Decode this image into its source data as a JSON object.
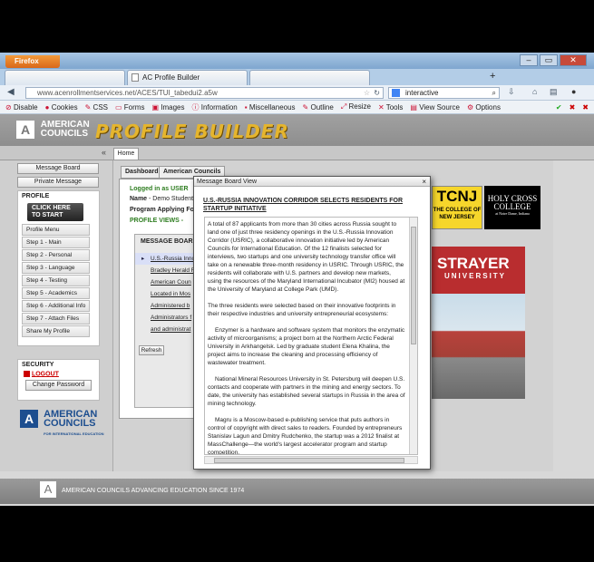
{
  "browser": {
    "menu_label": "Firefox",
    "tabs": [
      {
        "label": "AC Profile Builder"
      },
      {
        "label": ""
      }
    ],
    "new_tab": "+",
    "url": "www.acenrollmentservices.net/ACES/TUI_tabedui2.a5w",
    "search_value": "interactive",
    "window_buttons": [
      "–",
      "▭",
      "✕"
    ],
    "webdev_toolbar": [
      "Disable",
      "Cookies",
      "CSS",
      "Forms",
      "Images",
      "Information",
      "Miscellaneous",
      "Outline",
      "Resize",
      "Tools",
      "View Source",
      "Options"
    ]
  },
  "header": {
    "logo_line1": "AMERICAN",
    "logo_line2": "COUNCILS",
    "app_title": "PROFILE BUILDER",
    "collapse_icon": "«",
    "home_tab": "Home"
  },
  "sidebar": {
    "top_buttons": [
      "Message Board",
      "Private Message"
    ],
    "profile_title": "PROFILE",
    "click_to_start": [
      "CLICK HERE",
      "TO START"
    ],
    "profile_items": [
      "Profile Menu",
      "Step 1 - Main",
      "Step 2 - Personal",
      "Step 3 - Language",
      "Step 4 - Testing",
      "Step 5 - Academics",
      "Step 6 - Additional Info",
      "Step 7 - Attach Files",
      "Share My Profile"
    ],
    "security_title": "SECURITY",
    "logout": "LOGOUT",
    "change_password": "Change Password",
    "logo_line1": "AMERICAN",
    "logo_line2": "COUNCILS",
    "logo_tagline": "FOR INTERNATIONAL EDUCATION"
  },
  "content": {
    "tabs": [
      "Dashboard",
      "American Councils"
    ],
    "logged_in": "Logged in as USER",
    "name_label": "Name",
    "name_value": "- Demo Student",
    "program_label": "Program Applying For",
    "program_value": "-",
    "profile_views": "PROFILE VIEWS -",
    "message_board_title": "MESSAGE BOARD",
    "messages": [
      "U.S.-Russia Innovation",
      "Bradley Herald F",
      "American Coun",
      "Located in Mos",
      "Administered b",
      "Administrators f",
      "and administrat"
    ],
    "refresh": "Refresh",
    "tcnj": {
      "big": "TCNJ",
      "line1": "THE COLLEGE OF",
      "line2": "NEW JERSEY"
    },
    "holy_cross": {
      "line1": "HOLY CROSS",
      "line2": "COLLEGE",
      "line3": "at Notre Dame, Indiana"
    },
    "strayer": {
      "line1": "STRAYER",
      "line2": "UNIVERSITY"
    }
  },
  "modal": {
    "title": "Message Board View",
    "close": "×",
    "headline": "U.S.-RUSSIA INNOVATION CORRIDOR SELECTS RESIDENTS FOR STARTUP INITIATIVE",
    "paragraphs": [
      "A total of 87 applicants from more than 30 cities across Russia sought to land one of just three residency openings in the U.S.-Russia Innovation Corridor (USRIC), a collaborative innovation initiative led by American Councils for International Education. Of the 12 finalists selected for interviews, two startups and one university technology transfer office will take on a renewable three-month residency in USRIC. Through USRIC, the residents will collaborate with U.S. partners and develop new markets, using the resources of the Maryland International Incubator (MI2) housed at the University of Maryland at College Park (UMD).",
      "The three residents were selected based on their innovative footprints in their respective industries and university entrepreneurial ecosystems:",
      "Enzymer is a hardware and software system that monitors the enzymatic activity of microorganisms; a project born at the Northern Arctic Federal University in Arkhangelsk. Led by graduate student Elena Khalina, the project aims to increase the cleaning and processing efficiency of wastewater treatment.",
      "National Mineral Resources University in St. Petersburg will deepen U.S. contacts and cooperate with partners in the mining and energy sectors. To date, the university has established several startups in Russia in the area of mining technology.",
      "Magru is a Moscow-based e-publishing service that puts authors in control of copyright with direct sales to readers. Founded by entrepreneurs Stanislav Lagun and Dmitry Rudchenko, the startup was a 2012 finalist at MassChallenge—the world's largest accelerator program and startup competition."
    ]
  },
  "footer": {
    "text": "AMERICAN COUNCILS ADVANCING EDUCATION SINCE 1974"
  }
}
